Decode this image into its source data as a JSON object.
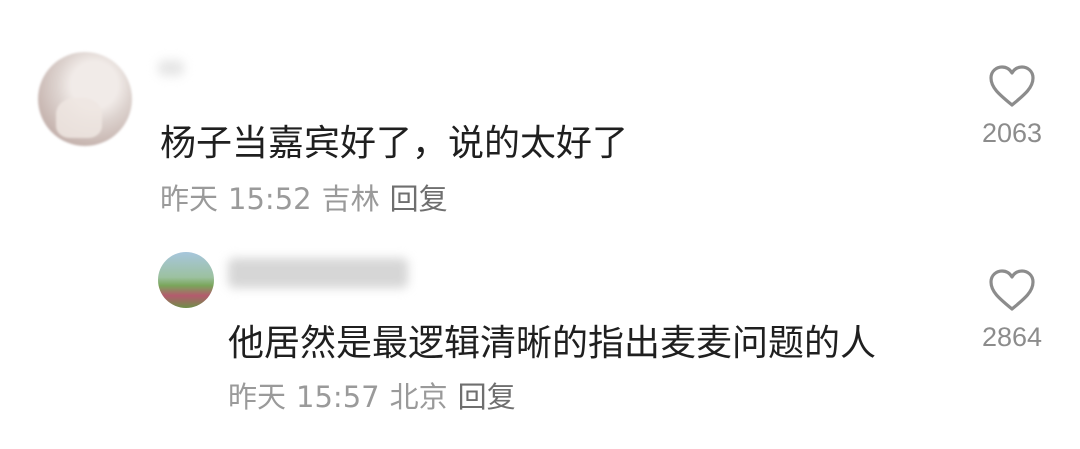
{
  "comments": [
    {
      "text": "杨子当嘉宾好了，说的太好了",
      "date": "昨天",
      "time": "15:52",
      "location": "吉林",
      "reply_label": "回复",
      "likes": "2063"
    },
    {
      "text": "他居然是最逻辑清晰的指出麦麦问题的人",
      "date": "昨天",
      "time": "15:57",
      "location": "北京",
      "reply_label": "回复",
      "likes": "2864"
    }
  ],
  "icons": {
    "like": "heart-outline-icon"
  },
  "colors": {
    "text": "#1f1f1f",
    "meta": "#9a9a9a",
    "icon": "#8c8c8c"
  }
}
